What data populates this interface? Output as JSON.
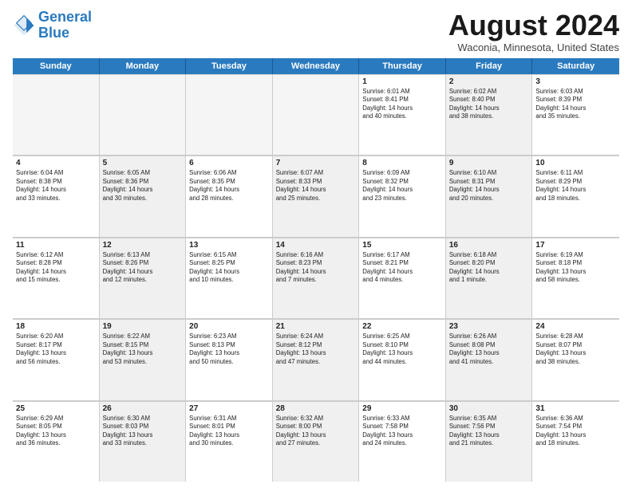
{
  "header": {
    "logo_line1": "General",
    "logo_line2": "Blue",
    "month_title": "August 2024",
    "location": "Waconia, Minnesota, United States"
  },
  "weekdays": [
    "Sunday",
    "Monday",
    "Tuesday",
    "Wednesday",
    "Thursday",
    "Friday",
    "Saturday"
  ],
  "rows": [
    [
      {
        "day": "",
        "text": "",
        "empty": true
      },
      {
        "day": "",
        "text": "",
        "empty": true
      },
      {
        "day": "",
        "text": "",
        "empty": true
      },
      {
        "day": "",
        "text": "",
        "empty": true
      },
      {
        "day": "1",
        "text": "Sunrise: 6:01 AM\nSunset: 8:41 PM\nDaylight: 14 hours\nand 40 minutes."
      },
      {
        "day": "2",
        "text": "Sunrise: 6:02 AM\nSunset: 8:40 PM\nDaylight: 14 hours\nand 38 minutes.",
        "shaded": true
      },
      {
        "day": "3",
        "text": "Sunrise: 6:03 AM\nSunset: 8:39 PM\nDaylight: 14 hours\nand 35 minutes."
      }
    ],
    [
      {
        "day": "4",
        "text": "Sunrise: 6:04 AM\nSunset: 8:38 PM\nDaylight: 14 hours\nand 33 minutes."
      },
      {
        "day": "5",
        "text": "Sunrise: 6:05 AM\nSunset: 8:36 PM\nDaylight: 14 hours\nand 30 minutes.",
        "shaded": true
      },
      {
        "day": "6",
        "text": "Sunrise: 6:06 AM\nSunset: 8:35 PM\nDaylight: 14 hours\nand 28 minutes."
      },
      {
        "day": "7",
        "text": "Sunrise: 6:07 AM\nSunset: 8:33 PM\nDaylight: 14 hours\nand 25 minutes.",
        "shaded": true
      },
      {
        "day": "8",
        "text": "Sunrise: 6:09 AM\nSunset: 8:32 PM\nDaylight: 14 hours\nand 23 minutes."
      },
      {
        "day": "9",
        "text": "Sunrise: 6:10 AM\nSunset: 8:31 PM\nDaylight: 14 hours\nand 20 minutes.",
        "shaded": true
      },
      {
        "day": "10",
        "text": "Sunrise: 6:11 AM\nSunset: 8:29 PM\nDaylight: 14 hours\nand 18 minutes."
      }
    ],
    [
      {
        "day": "11",
        "text": "Sunrise: 6:12 AM\nSunset: 8:28 PM\nDaylight: 14 hours\nand 15 minutes."
      },
      {
        "day": "12",
        "text": "Sunrise: 6:13 AM\nSunset: 8:26 PM\nDaylight: 14 hours\nand 12 minutes.",
        "shaded": true
      },
      {
        "day": "13",
        "text": "Sunrise: 6:15 AM\nSunset: 8:25 PM\nDaylight: 14 hours\nand 10 minutes."
      },
      {
        "day": "14",
        "text": "Sunrise: 6:16 AM\nSunset: 8:23 PM\nDaylight: 14 hours\nand 7 minutes.",
        "shaded": true
      },
      {
        "day": "15",
        "text": "Sunrise: 6:17 AM\nSunset: 8:21 PM\nDaylight: 14 hours\nand 4 minutes."
      },
      {
        "day": "16",
        "text": "Sunrise: 6:18 AM\nSunset: 8:20 PM\nDaylight: 14 hours\nand 1 minute.",
        "shaded": true
      },
      {
        "day": "17",
        "text": "Sunrise: 6:19 AM\nSunset: 8:18 PM\nDaylight: 13 hours\nand 58 minutes."
      }
    ],
    [
      {
        "day": "18",
        "text": "Sunrise: 6:20 AM\nSunset: 8:17 PM\nDaylight: 13 hours\nand 56 minutes."
      },
      {
        "day": "19",
        "text": "Sunrise: 6:22 AM\nSunset: 8:15 PM\nDaylight: 13 hours\nand 53 minutes.",
        "shaded": true
      },
      {
        "day": "20",
        "text": "Sunrise: 6:23 AM\nSunset: 8:13 PM\nDaylight: 13 hours\nand 50 minutes."
      },
      {
        "day": "21",
        "text": "Sunrise: 6:24 AM\nSunset: 8:12 PM\nDaylight: 13 hours\nand 47 minutes.",
        "shaded": true
      },
      {
        "day": "22",
        "text": "Sunrise: 6:25 AM\nSunset: 8:10 PM\nDaylight: 13 hours\nand 44 minutes."
      },
      {
        "day": "23",
        "text": "Sunrise: 6:26 AM\nSunset: 8:08 PM\nDaylight: 13 hours\nand 41 minutes.",
        "shaded": true
      },
      {
        "day": "24",
        "text": "Sunrise: 6:28 AM\nSunset: 8:07 PM\nDaylight: 13 hours\nand 38 minutes."
      }
    ],
    [
      {
        "day": "25",
        "text": "Sunrise: 6:29 AM\nSunset: 8:05 PM\nDaylight: 13 hours\nand 36 minutes."
      },
      {
        "day": "26",
        "text": "Sunrise: 6:30 AM\nSunset: 8:03 PM\nDaylight: 13 hours\nand 33 minutes.",
        "shaded": true
      },
      {
        "day": "27",
        "text": "Sunrise: 6:31 AM\nSunset: 8:01 PM\nDaylight: 13 hours\nand 30 minutes."
      },
      {
        "day": "28",
        "text": "Sunrise: 6:32 AM\nSunset: 8:00 PM\nDaylight: 13 hours\nand 27 minutes.",
        "shaded": true
      },
      {
        "day": "29",
        "text": "Sunrise: 6:33 AM\nSunset: 7:58 PM\nDaylight: 13 hours\nand 24 minutes."
      },
      {
        "day": "30",
        "text": "Sunrise: 6:35 AM\nSunset: 7:56 PM\nDaylight: 13 hours\nand 21 minutes.",
        "shaded": true
      },
      {
        "day": "31",
        "text": "Sunrise: 6:36 AM\nSunset: 7:54 PM\nDaylight: 13 hours\nand 18 minutes."
      }
    ]
  ]
}
